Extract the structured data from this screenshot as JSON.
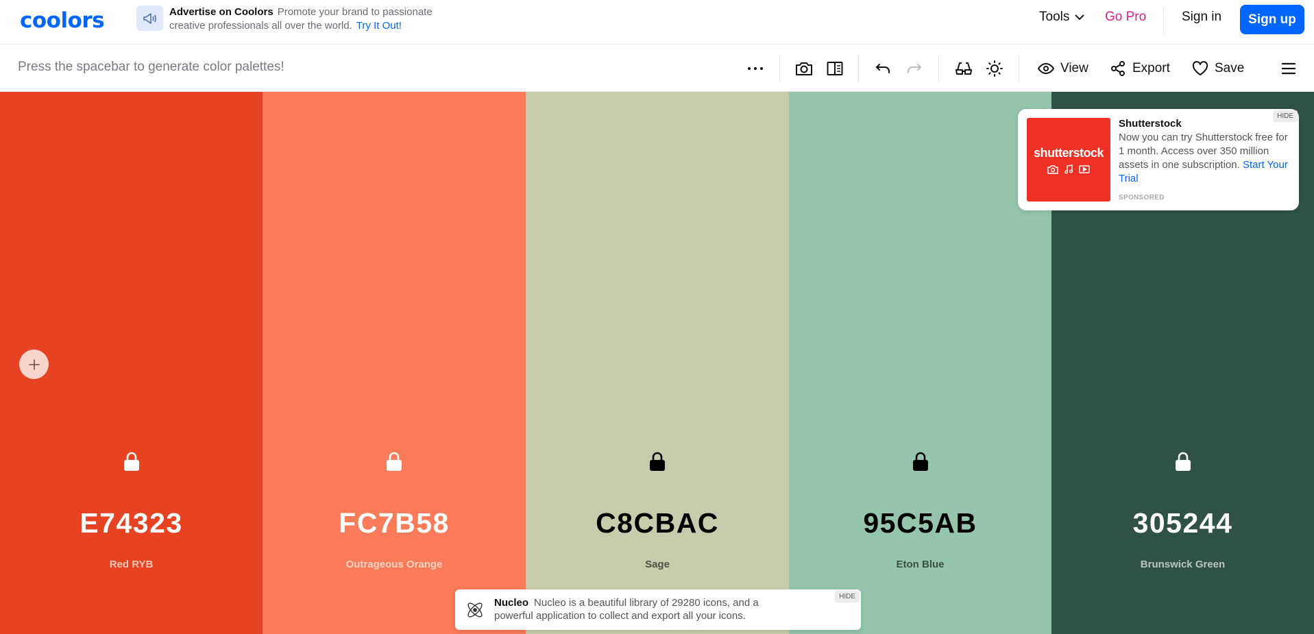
{
  "nav": {
    "logo": "coolors",
    "promo_title": "Advertise on Coolors",
    "promo_text": "Promote your brand to passionate creative professionals all over the world.",
    "promo_link": "Try It Out!",
    "tools": "Tools",
    "go_pro": "Go Pro",
    "sign_in": "Sign in",
    "sign_up": "Sign up"
  },
  "toolbar": {
    "hint": "Press the spacebar to generate color palettes!",
    "view": "View",
    "export": "Export",
    "save": "Save",
    "icons": [
      "more-icon",
      "camera-icon",
      "layout-icon",
      "undo-icon",
      "redo-icon",
      "glasses-icon",
      "sun-icon",
      "eye-icon",
      "share-icon",
      "heart-icon",
      "menu-icon"
    ]
  },
  "palette": [
    {
      "hex": "E74323",
      "name": "Red RYB",
      "color": "#E74323",
      "text_color": "#ffffff",
      "name_color": "#f5c4b8"
    },
    {
      "hex": "FC7B58",
      "name": "Outrageous Orange",
      "color": "#FC7B58",
      "text_color": "#ffffff",
      "name_color": "#fdd3c6"
    },
    {
      "hex": "C8CBAC",
      "name": "Sage",
      "color": "#C8CBAC",
      "text_color": "#000000",
      "name_color": "#4d4f43"
    },
    {
      "hex": "95C5AB",
      "name": "Eton Blue",
      "color": "#95C5AB",
      "text_color": "#000000",
      "name_color": "#3c5045"
    },
    {
      "hex": "305244",
      "name": "Brunswick Green",
      "color": "#305244",
      "text_color": "#ffffff",
      "name_color": "#b9c4bf"
    }
  ],
  "ad": {
    "brand": "shutterstock",
    "title": "Shutterstock",
    "body": "Now you can try Shutterstock free for 1 month. Access over 350 million assets in one subscription.",
    "cta": "Start Your Trial",
    "sponsored": "SPONSORED",
    "hide": "HIDE"
  },
  "bottom_ad": {
    "title": "Nucleo",
    "body": "Nucleo is a beautiful library of 29280 icons, and a powerful application to collect and export all your icons.",
    "hide": "HIDE"
  }
}
